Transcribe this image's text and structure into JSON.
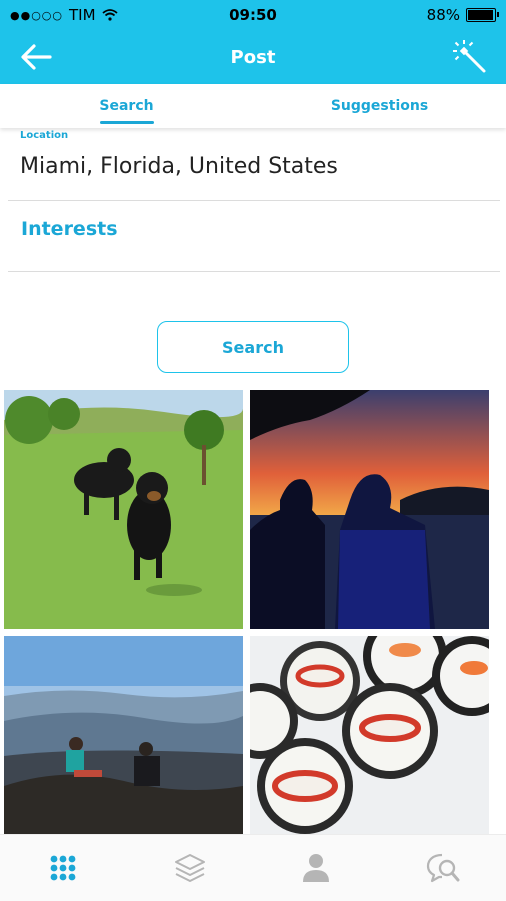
{
  "status_bar": {
    "carrier": "TIM",
    "time": "09:50",
    "battery": "88%",
    "battery_level": 0.88,
    "signal_icon": "signal-dots-icon",
    "wifi_icon": "wifi-icon"
  },
  "header": {
    "title": "Post",
    "back_icon": "arrow-left-icon",
    "action_icon": "magic-wand-icon",
    "color": "#1ec3ea"
  },
  "tabs": [
    {
      "label": "Search",
      "active": true
    },
    {
      "label": "Suggestions",
      "active": false
    }
  ],
  "form": {
    "location_label": "Location",
    "location_value": "Miami, Florida, United States",
    "interests_label": "Interests"
  },
  "search_button": {
    "label": "Search"
  },
  "photos": [
    {
      "name": "dogs-in-field-photo"
    },
    {
      "name": "sunset-silhouettes-photo"
    },
    {
      "name": "mountain-view-photo"
    },
    {
      "name": "sushi-photo"
    }
  ],
  "bottom_nav": [
    {
      "icon": "grid-icon",
      "active": true
    },
    {
      "icon": "layers-icon",
      "active": false
    },
    {
      "icon": "person-icon",
      "active": false
    },
    {
      "icon": "chat-search-icon",
      "active": false
    }
  ],
  "colors": {
    "accent": "#1ba7d6",
    "inactive_icon": "#b5b5b5"
  }
}
